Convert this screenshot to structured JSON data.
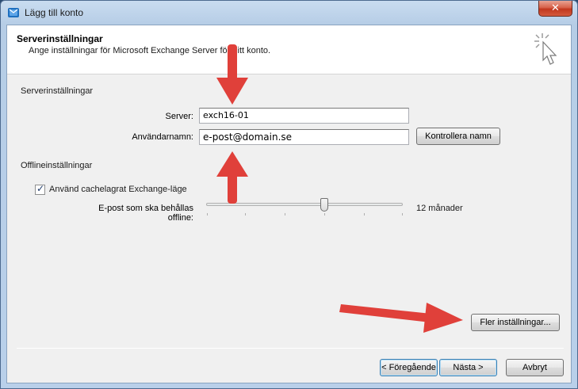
{
  "window": {
    "title": "Lägg till konto",
    "close_glyph": "✕"
  },
  "header": {
    "title": "Serverinställningar",
    "subtitle": "Ange inställningar för Microsoft Exchange Server för ditt konto."
  },
  "server_section": {
    "title": "Serverinställningar",
    "server_label": "Server:",
    "server_value": "exch16-01",
    "username_label": "Användarnamn:",
    "username_value": "e-post@domain.se",
    "check_name_label": "Kontrollera namn"
  },
  "offline_section": {
    "title": "Offlineinställningar",
    "cached_mode_label": "Använd cachelagrat Exchange-läge",
    "cached_mode_checked": true,
    "keep_offline_label": "E-post som ska behållas offline:",
    "keep_offline_value": "12 månader",
    "slider_level": 0.6
  },
  "buttons": {
    "more_settings": "Fler inställningar...",
    "back": "< Föregående",
    "next": "Nästa >",
    "cancel": "Avbryt"
  },
  "colors": {
    "annotation_arrow": "#e0403a",
    "close_button": "#c2371e"
  },
  "icons": [
    "outlook-icon",
    "close-icon",
    "wizard-cursor-icon",
    "checkmark-icon",
    "arrow-annotation-icon"
  ]
}
